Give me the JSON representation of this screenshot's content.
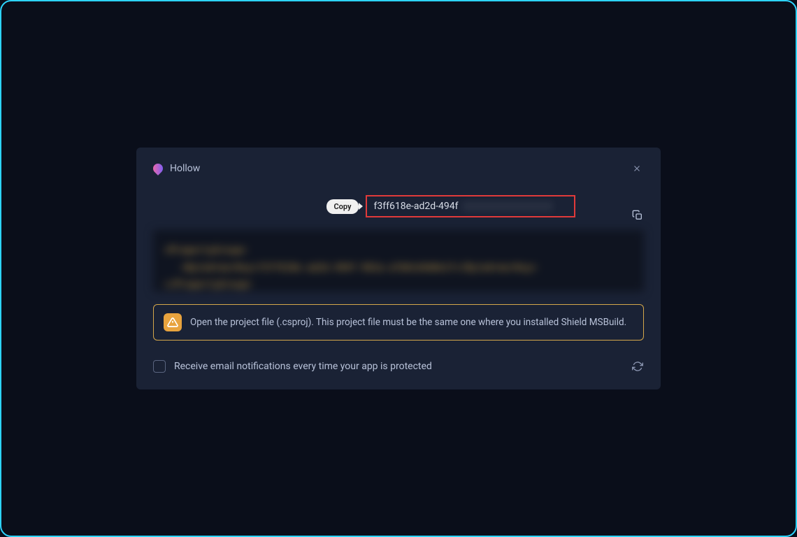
{
  "dialog": {
    "title": "Hollow",
    "copy_label": "Copy",
    "key_visible": "f3ff618e-ad2d-494f",
    "code_lines": {
      "l1": "<PropertyGroup>",
      "l2": "<ByteArmorKey>f3ff618e-ad2d-494f-962a-a7b8cb9d0e1f</ByteArmorKey>",
      "l3": "</PropertyGroup>"
    },
    "alert_text": "Open the project file (.csproj). This project file must be the same one where you installed Shield MSBuild.",
    "checkbox_label": "Receive email notifications every time your app is protected"
  }
}
